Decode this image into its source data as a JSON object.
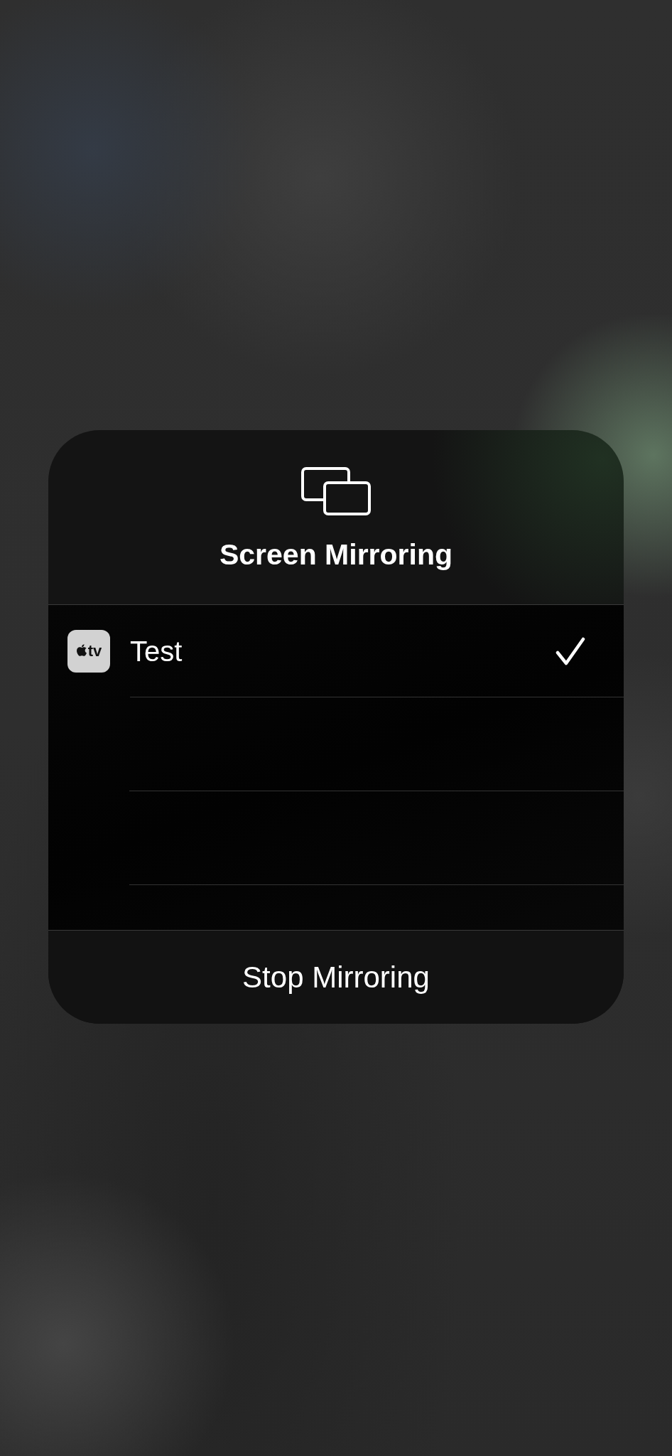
{
  "panel": {
    "title": "Screen Mirroring"
  },
  "devices": [
    {
      "name": "Test",
      "icon_label": "tv",
      "selected": true
    }
  ],
  "stop_button": {
    "label": "Stop Mirroring"
  }
}
